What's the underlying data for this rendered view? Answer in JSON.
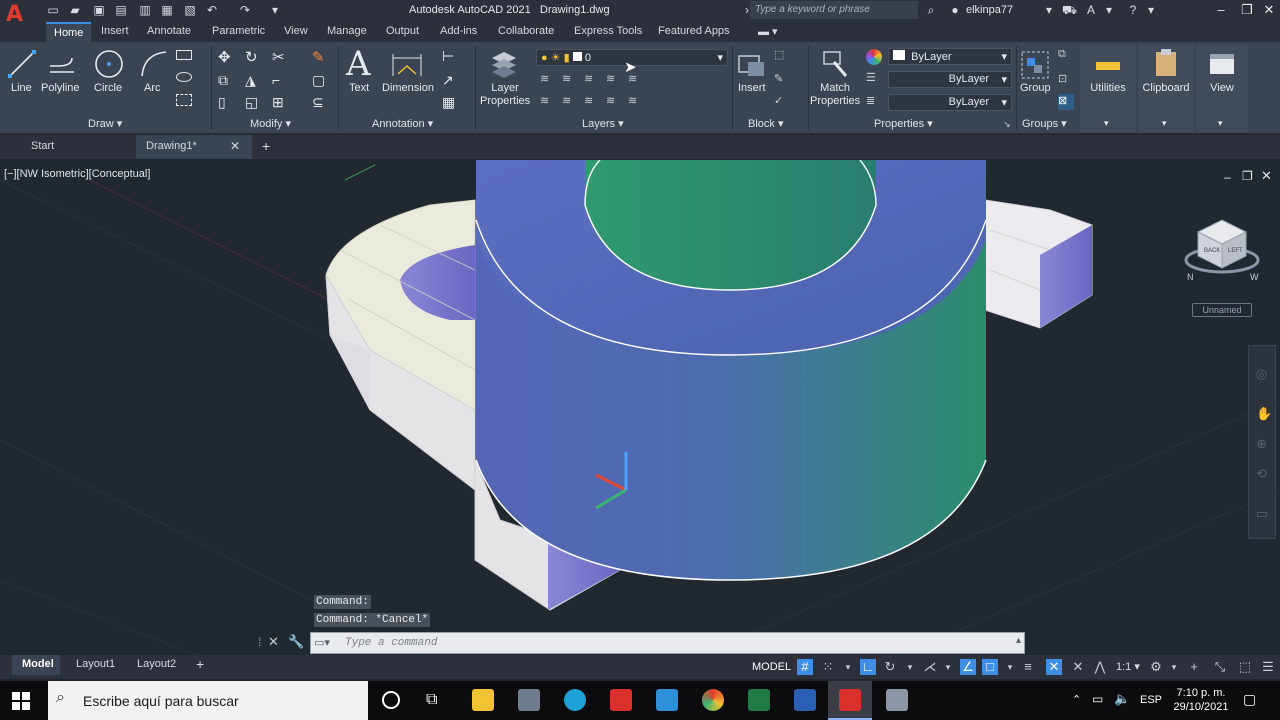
{
  "window": {
    "app_title": "Autodesk AutoCAD 2021",
    "doc_title": "Drawing1.dwg",
    "search_placeholder": "Type a keyword or phrase",
    "user": "elkinpa77",
    "logo_letter": "A"
  },
  "ribbon_tabs": [
    "Home",
    "Insert",
    "Annotate",
    "Parametric",
    "View",
    "Manage",
    "Output",
    "Add-ins",
    "Collaborate",
    "Express Tools",
    "Featured Apps"
  ],
  "ribbon": {
    "draw": {
      "title": "Draw",
      "line": "Line",
      "polyline": "Polyline",
      "circle": "Circle",
      "arc": "Arc"
    },
    "modify": {
      "title": "Modify"
    },
    "annotation": {
      "title": "Annotation",
      "text": "Text",
      "dimension": "Dimension"
    },
    "layers": {
      "title": "Layers",
      "layer_properties_1": "Layer",
      "layer_properties_2": "Properties",
      "current_layer": "0"
    },
    "block": {
      "title": "Block",
      "insert": "Insert"
    },
    "properties": {
      "title": "Properties",
      "match_1": "Match",
      "match_2": "Properties",
      "color": "ByLayer",
      "linetype": "ByLayer",
      "lineweight": "ByLayer"
    },
    "groups": {
      "title": "Groups",
      "group": "Group"
    },
    "utilities": "Utilities",
    "clipboard": "Clipboard",
    "view": "View"
  },
  "doc_tabs": {
    "start": "Start",
    "drawing": "Drawing1*"
  },
  "viewport": {
    "label": "[−][NW Isometric][Conceptual]",
    "viewcube_name": "Unnamed",
    "viewcube_faces": [
      "BACK",
      "LEFT"
    ],
    "compass": [
      "N",
      "W"
    ]
  },
  "command": {
    "history": [
      "Command:",
      "Command: *Cancel*"
    ],
    "placeholder": "Type a command"
  },
  "layout_tabs": [
    "Model",
    "Layout1",
    "Layout2"
  ],
  "status": {
    "model": "MODEL",
    "scale": "1:1"
  },
  "taskbar": {
    "search": "Escribe aquí para buscar",
    "lang": "ESP",
    "time": "7:10 p. m.",
    "date": "29/10/2021"
  },
  "colors": {
    "cylinder_blue": "#5567b6",
    "cylinder_green": "#2e8f6c",
    "base_face": "#e9e9dc",
    "accent": "#3e8ee6"
  }
}
